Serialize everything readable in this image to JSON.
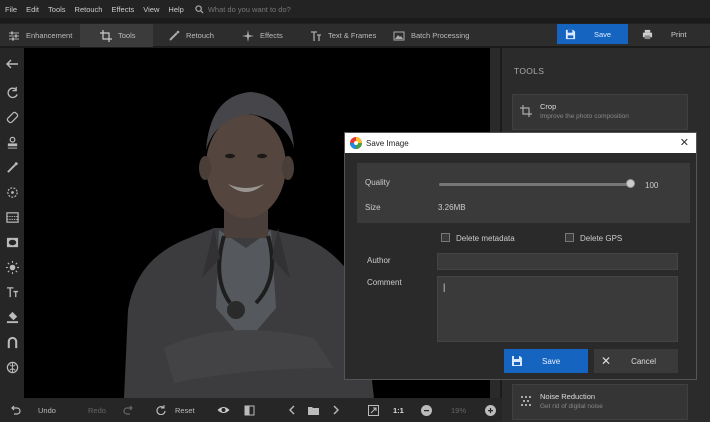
{
  "menu": {
    "items": [
      "File",
      "Edit",
      "Tools",
      "Retouch",
      "Effects",
      "View",
      "Help"
    ],
    "search_placeholder": "What do you want to do?"
  },
  "tabs": [
    {
      "label": "Enhancement",
      "icon": "sliders-icon"
    },
    {
      "label": "Tools",
      "icon": "crop-icon",
      "active": true
    },
    {
      "label": "Retouch",
      "icon": "brush-icon"
    },
    {
      "label": "Effects",
      "icon": "sparkle-icon"
    },
    {
      "label": "Text & Frames",
      "icon": "text-icon"
    },
    {
      "label": "Batch Processing",
      "icon": "images-icon"
    }
  ],
  "topbar": {
    "save_label": "Save",
    "print_label": "Print"
  },
  "right_panel": {
    "title": "TOOLS",
    "cards": [
      {
        "title": "Crop",
        "subtitle": "Improve the photo composition"
      },
      {
        "title": "Noise Reduction",
        "subtitle": "Get rid of digital noise"
      }
    ]
  },
  "bottombar": {
    "undo": "Undo",
    "redo": "Redo",
    "reset": "Reset",
    "ratio": "1:1",
    "zoom": "19%"
  },
  "dialog": {
    "title": "Save Image",
    "quality_label": "Quality",
    "quality_value": "100",
    "quality_level": 1.0,
    "size_label": "Size",
    "size_value": "3.26MB",
    "delete_metadata": "Delete metadata",
    "delete_gps": "Delete GPS",
    "author_label": "Author",
    "author_value": "",
    "comment_label": "Comment",
    "comment_value": "",
    "save_label": "Save",
    "cancel_label": "Cancel"
  },
  "colors": {
    "accent": "#1565c0",
    "panel": "#2b2b2b",
    "dialog_bg": "#2a2a2a"
  }
}
